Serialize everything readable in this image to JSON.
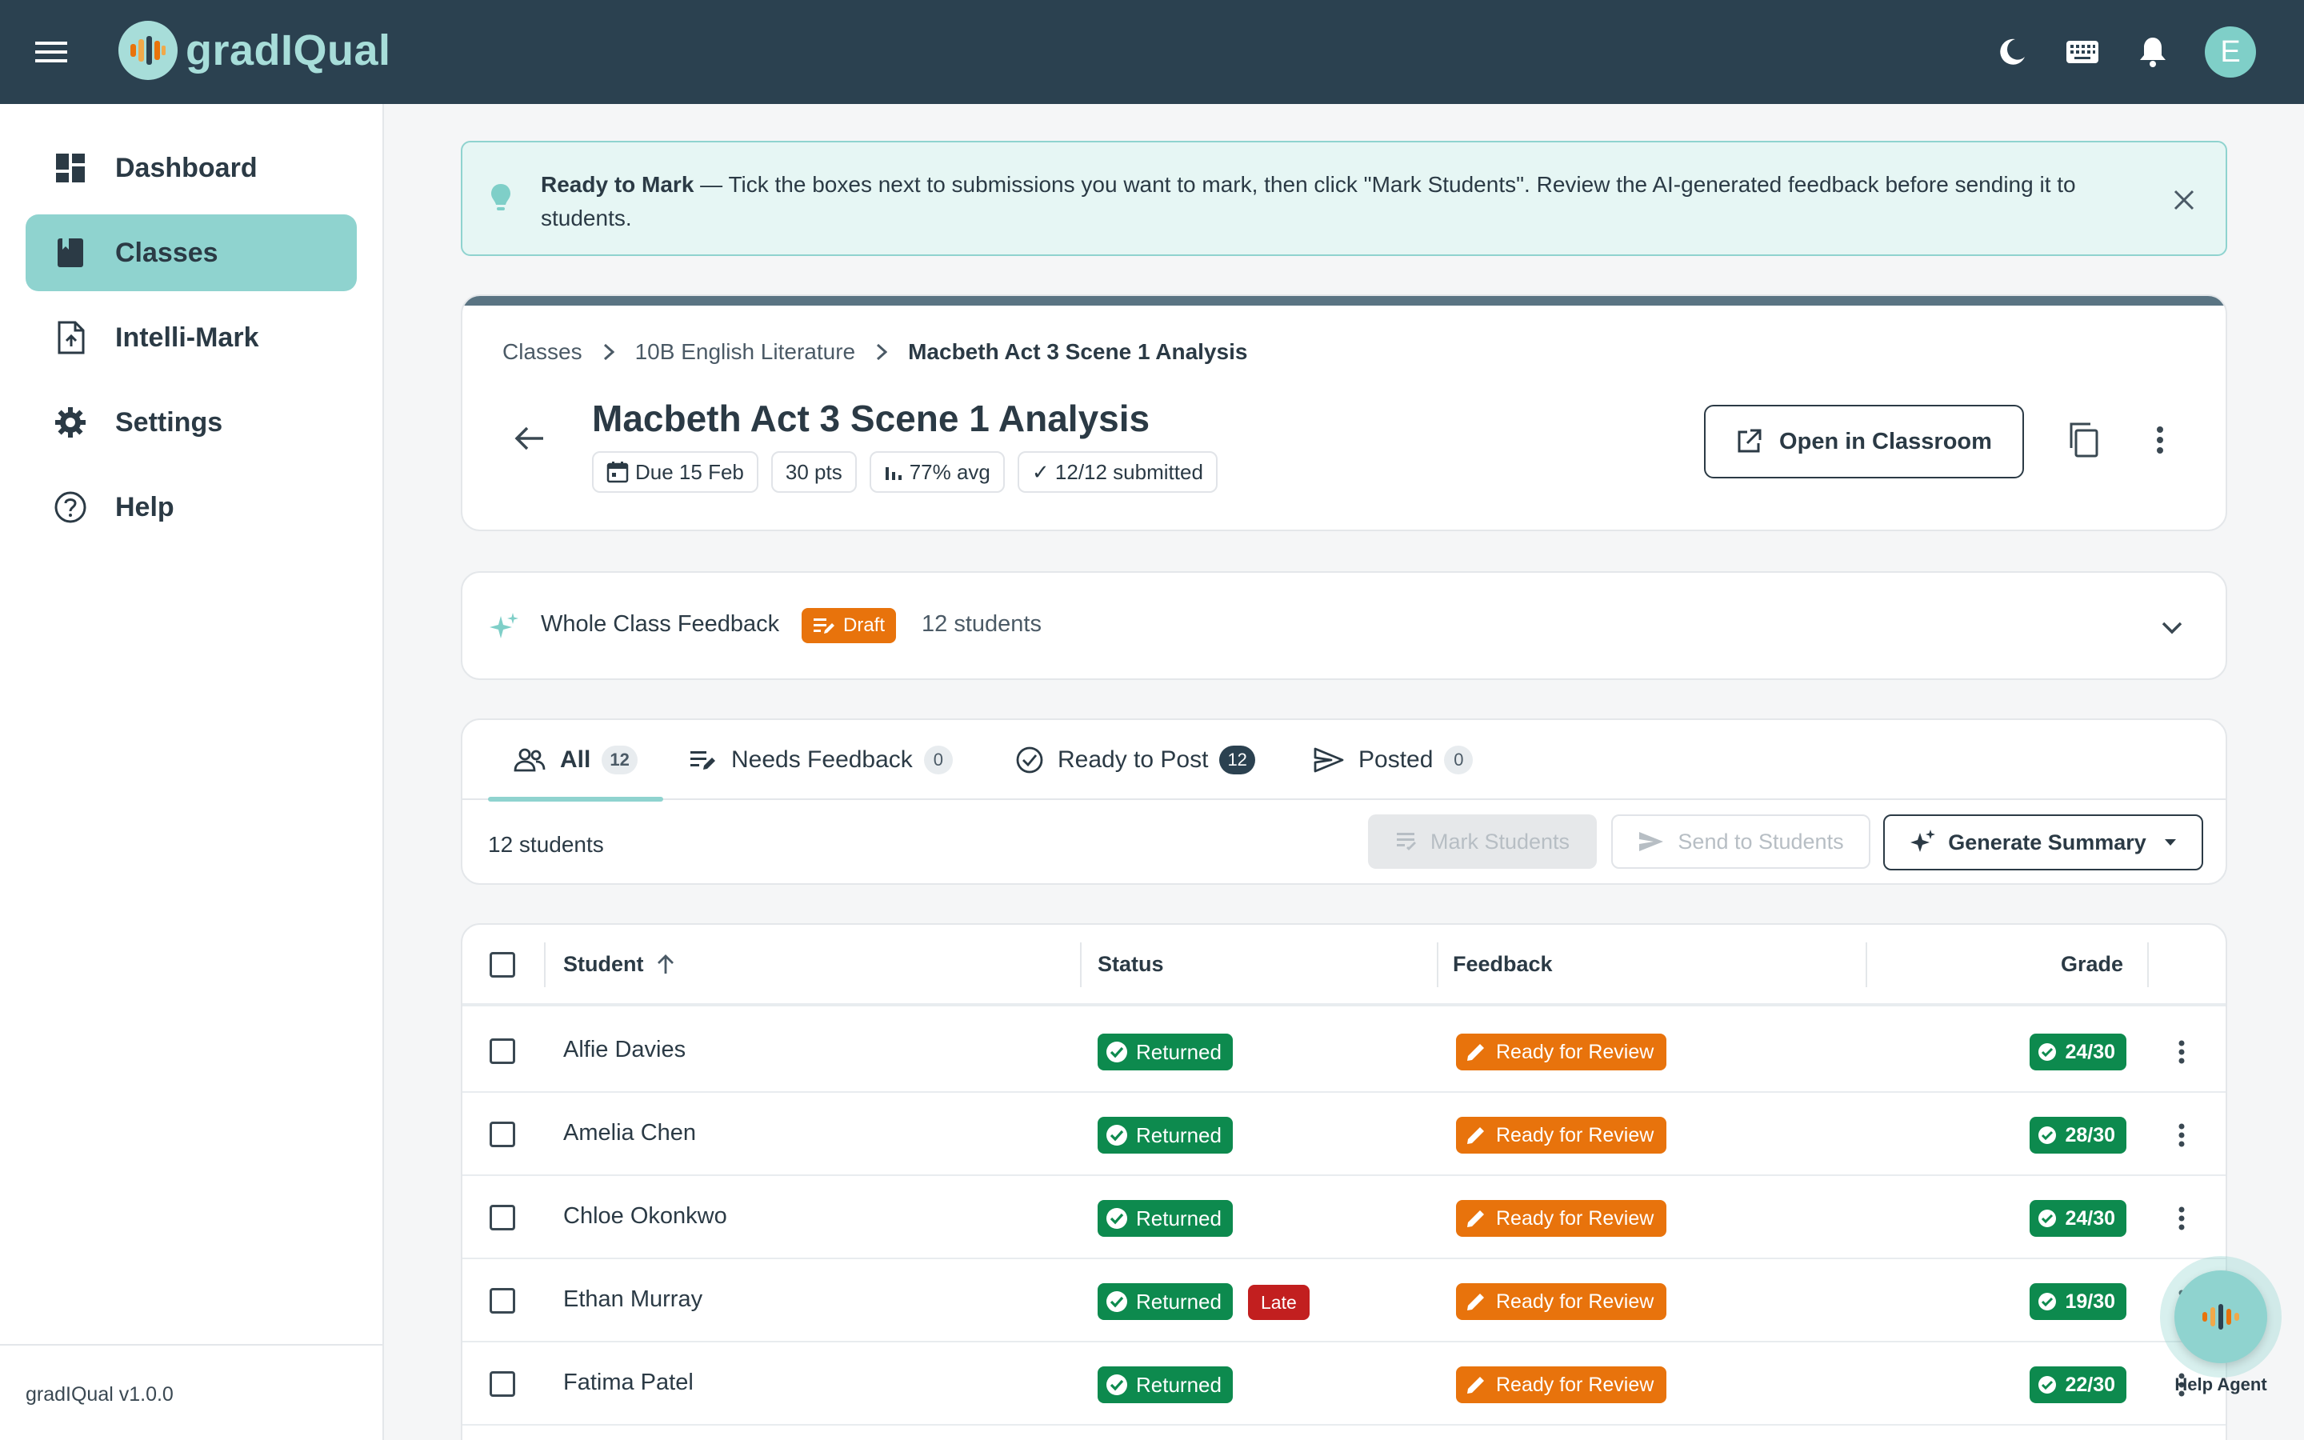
{
  "app": {
    "name": "gradIQual",
    "version": "gradIQual v1.0.0",
    "user_initial": "E",
    "colors": {
      "topbar": "#2b4150",
      "accent": "#8fd3cf",
      "success": "#0d8a4e",
      "warning": "#e8730c",
      "danger": "#c21f1f"
    }
  },
  "topbar": {
    "icons": [
      "menu-icon",
      "moon-icon",
      "keyboard-icon",
      "bell-icon"
    ]
  },
  "sidebar": {
    "items": [
      {
        "label": "Dashboard",
        "icon": "dashboard-icon",
        "active": false
      },
      {
        "label": "Classes",
        "icon": "book-icon",
        "active": true
      },
      {
        "label": "Intelli-Mark",
        "icon": "file-upload-icon",
        "active": false
      },
      {
        "label": "Settings",
        "icon": "gear-icon",
        "active": false
      },
      {
        "label": "Help",
        "icon": "help-circle-icon",
        "active": false
      }
    ]
  },
  "banner": {
    "title": "Ready to Mark",
    "text": " — Tick the boxes next to submissions you want to mark, then click \"Mark Students\". Review the AI-generated feedback before sending it to students."
  },
  "assignment": {
    "breadcrumb": [
      "Classes",
      "10B English Literature",
      "Macbeth Act 3 Scene 1 Analysis"
    ],
    "title": "Macbeth Act 3 Scene 1 Analysis",
    "chips": {
      "due": "Due 15 Feb",
      "points": "30 pts",
      "avg": "77% avg",
      "submitted": "✓ 12/12 submitted"
    },
    "open_button": "Open in Classroom"
  },
  "whole_class_feedback": {
    "label": "Whole Class Feedback",
    "badge": "Draft",
    "count": "12 students"
  },
  "tabs": [
    {
      "label": "All",
      "count": "12",
      "active": true
    },
    {
      "label": "Needs Feedback",
      "count": "0",
      "active": false
    },
    {
      "label": "Ready to Post",
      "count": "12",
      "active": false
    },
    {
      "label": "Posted",
      "count": "0",
      "active": false
    }
  ],
  "toolbar": {
    "students_count": "12 students",
    "mark_label": "Mark Students",
    "send_label": "Send to Students",
    "generate_label": "Generate Summary"
  },
  "table": {
    "columns": {
      "student": "Student",
      "status": "Status",
      "feedback": "Feedback",
      "grade": "Grade"
    },
    "rows": [
      {
        "name": "Alfie Davies",
        "status": "Returned",
        "late": "",
        "feedback": "Ready for Review",
        "grade": "24/30"
      },
      {
        "name": "Amelia Chen",
        "status": "Returned",
        "late": "",
        "feedback": "Ready for Review",
        "grade": "28/30"
      },
      {
        "name": "Chloe Okonkwo",
        "status": "Returned",
        "late": "",
        "feedback": "Ready for Review",
        "grade": "24/30"
      },
      {
        "name": "Ethan Murray",
        "status": "Returned",
        "late": "Late",
        "feedback": "Ready for Review",
        "grade": "19/30"
      },
      {
        "name": "Fatima Patel",
        "status": "Returned",
        "late": "",
        "feedback": "Ready for Review",
        "grade": "22/30"
      }
    ]
  },
  "help_agent": {
    "label": "Help Agent"
  }
}
